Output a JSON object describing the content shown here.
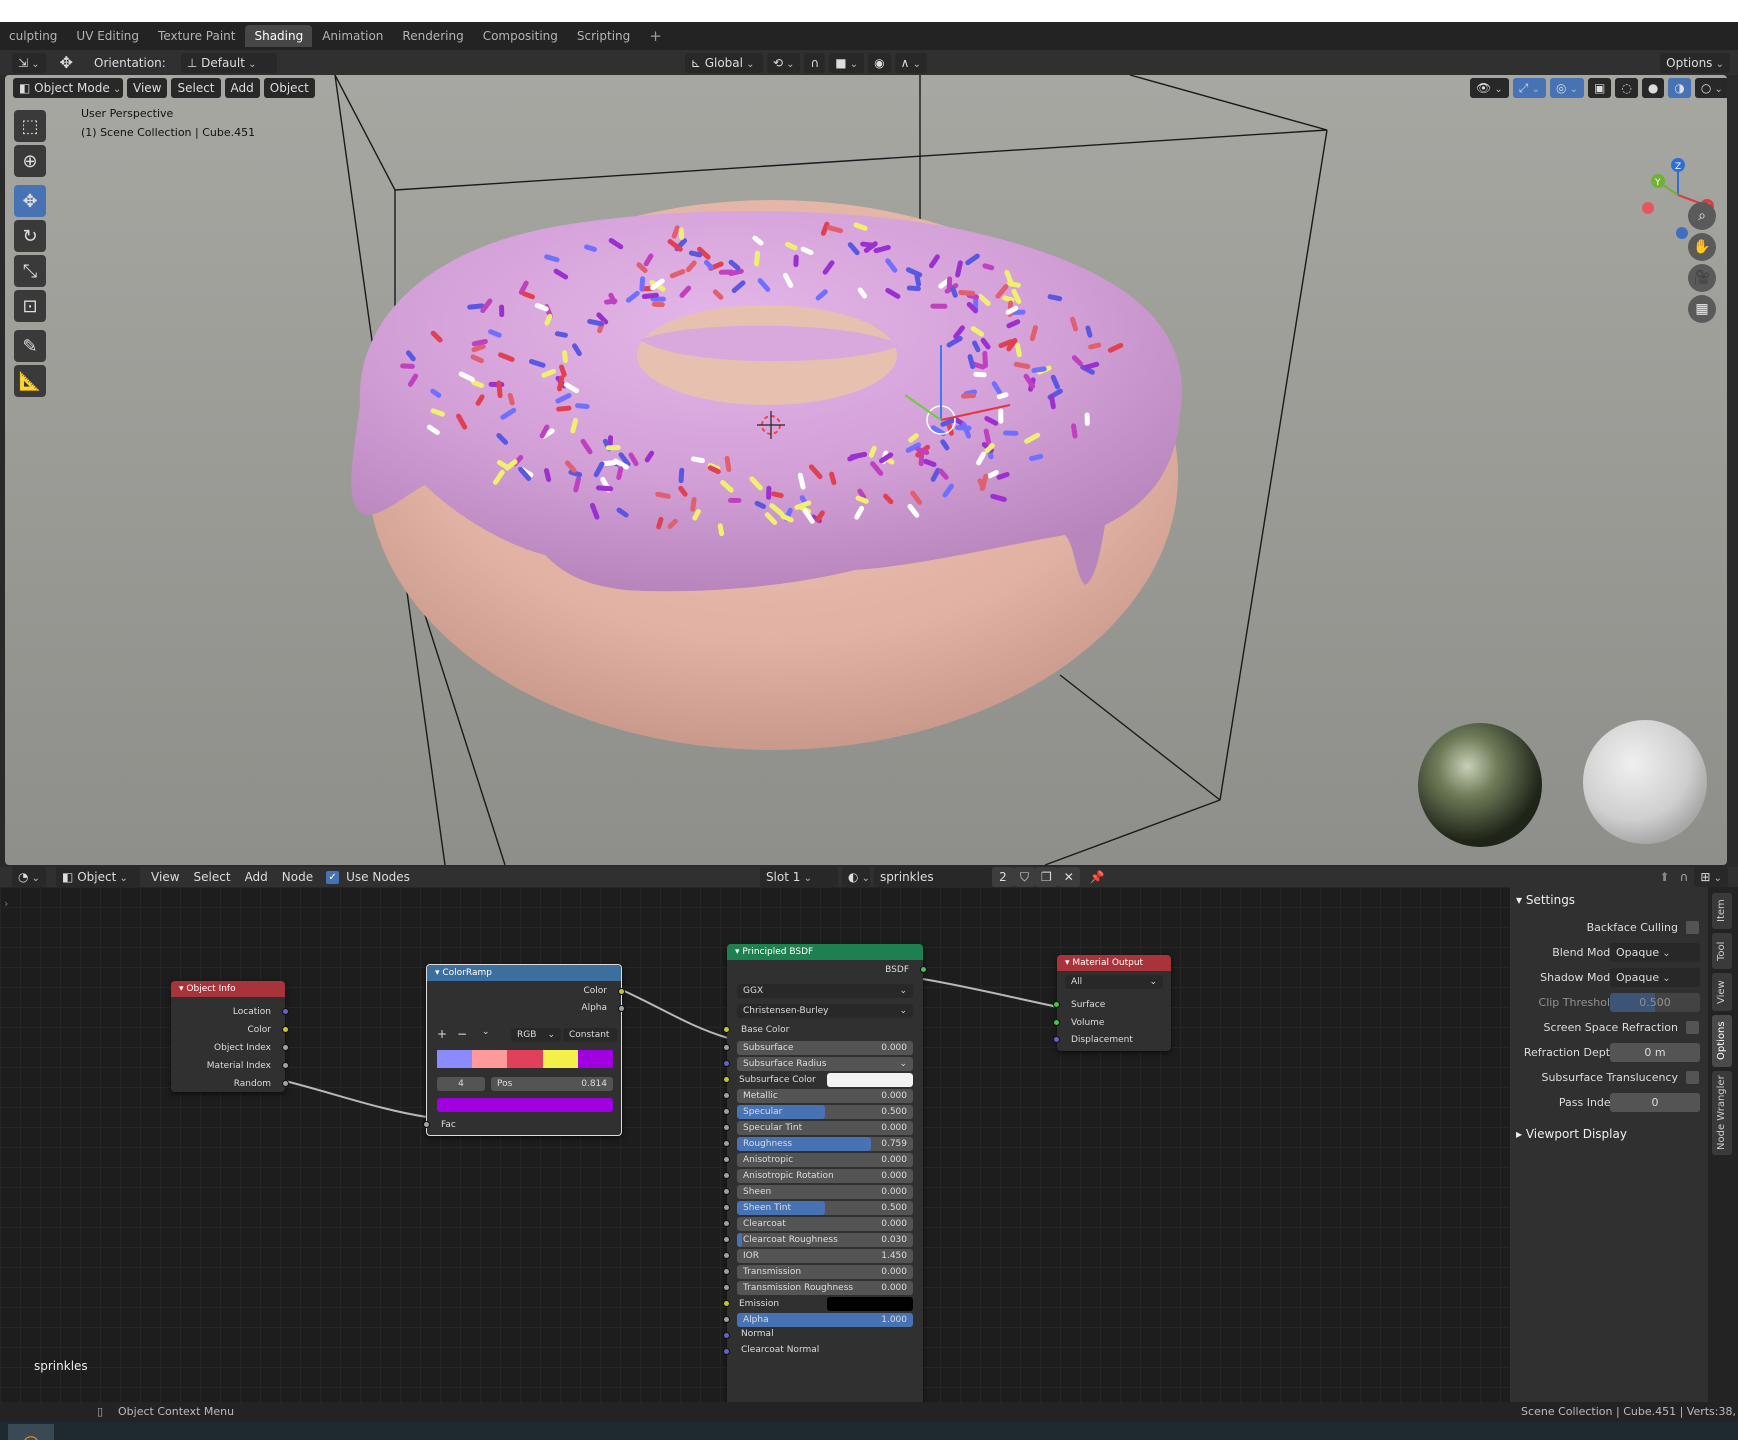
{
  "workspace_tabs": [
    "culpting",
    "UV Editing",
    "Texture Paint",
    "Shading",
    "Animation",
    "Rendering",
    "Compositing",
    "Scripting",
    "+"
  ],
  "active_tab": "Shading",
  "tool_header": {
    "orientation_label": "Orientation:",
    "orientation_value": "Default",
    "transform_orientation": "Global",
    "options": "Options"
  },
  "viewport_header": {
    "mode": "Object Mode",
    "menus": [
      "View",
      "Select",
      "Add",
      "Object"
    ]
  },
  "viewport": {
    "perspective": "User Perspective",
    "collection": "(1) Scene Collection | Cube.451",
    "gizmo_axes": [
      "Z",
      "Y",
      "X"
    ],
    "nav_icons": [
      "zoom-icon",
      "pan-hand-icon",
      "camera-icon",
      "grid-icon"
    ]
  },
  "toolbar_icons": [
    "select-box-icon",
    "cursor-icon",
    "move-icon",
    "rotate-icon",
    "scale-icon",
    "transform-icon",
    "annotate-icon",
    "measure-icon"
  ],
  "node_header": {
    "type": "Object",
    "menus": [
      "View",
      "Select",
      "Add",
      "Node"
    ],
    "use_nodes_label": "Use Nodes",
    "use_nodes_checked": true,
    "slot": "Slot 1",
    "material": "sprinkles",
    "users": "2"
  },
  "nodes": {
    "object_info": {
      "title": "Object Info",
      "outputs": [
        "Location",
        "Color",
        "Object Index",
        "Material Index",
        "Random"
      ]
    },
    "color_ramp": {
      "title": "ColorRamp",
      "outputs": [
        "Color",
        "Alpha"
      ],
      "mode": "RGB",
      "interpolation": "Constant",
      "active_index": "4",
      "pos_label": "Pos",
      "pos_value": "0.814",
      "input": "Fac",
      "stop_colors": [
        "#8b8bff",
        "#ff9a9a",
        "#e0405a",
        "#f4f04a",
        "#a000e0"
      ],
      "active_color": "#a000e0"
    },
    "principled": {
      "title": "Principled BSDF",
      "output": "BSDF",
      "distribution": "GGX",
      "subsurface_method": "Christensen-Burley",
      "base_color_label": "Base Color",
      "fields": [
        {
          "label": "Subsurface",
          "value": "0.000",
          "fill": 0
        },
        {
          "label": "Subsurface Radius",
          "value": "",
          "fill": 0
        },
        {
          "label": "Subsurface Color",
          "value": "",
          "fill": 0
        },
        {
          "label": "Metallic",
          "value": "0.000",
          "fill": 0
        },
        {
          "label": "Specular",
          "value": "0.500",
          "fill": 0.5
        },
        {
          "label": "Specular Tint",
          "value": "0.000",
          "fill": 0
        },
        {
          "label": "Roughness",
          "value": "0.759",
          "fill": 0.759
        },
        {
          "label": "Anisotropic",
          "value": "0.000",
          "fill": 0
        },
        {
          "label": "Anisotropic Rotation",
          "value": "0.000",
          "fill": 0
        },
        {
          "label": "Sheen",
          "value": "0.000",
          "fill": 0
        },
        {
          "label": "Sheen Tint",
          "value": "0.500",
          "fill": 0.5
        },
        {
          "label": "Clearcoat",
          "value": "0.000",
          "fill": 0
        },
        {
          "label": "Clearcoat Roughness",
          "value": "0.030",
          "fill": 0.03
        },
        {
          "label": "IOR",
          "value": "1.450",
          "fill": 0
        },
        {
          "label": "Transmission",
          "value": "0.000",
          "fill": 0
        },
        {
          "label": "Transmission Roughness",
          "value": "0.000",
          "fill": 0
        },
        {
          "label": "Emission",
          "value": "",
          "fill": 0
        },
        {
          "label": "Alpha",
          "value": "1.000",
          "fill": 1
        }
      ],
      "vector_inputs": [
        "Normal",
        "Clearcoat Normal"
      ]
    },
    "material_output": {
      "title": "Material Output",
      "target": "All",
      "inputs": [
        "Surface",
        "Volume",
        "Displacement"
      ]
    }
  },
  "node_editor_label": "sprinkles",
  "properties": {
    "settings_title": "Settings",
    "rows": [
      {
        "label": "Backface Culling",
        "type": "check"
      },
      {
        "label": "Blend Mode",
        "type": "select",
        "value": "Opaque"
      },
      {
        "label": "Shadow Mode",
        "type": "select",
        "value": "Opaque"
      },
      {
        "label": "Clip Threshold",
        "type": "field",
        "value": "0.500"
      },
      {
        "label": "Screen Space Refraction",
        "type": "check"
      },
      {
        "label": "Refraction Depth",
        "type": "field",
        "value": "0 m"
      },
      {
        "label": "Subsurface Translucency",
        "type": "check"
      },
      {
        "label": "Pass Index",
        "type": "field",
        "value": "0"
      }
    ],
    "viewport_display": "Viewport Display"
  },
  "side_tabs": [
    "Item",
    "Tool",
    "View",
    "Options",
    "Node Wrangler"
  ],
  "status": {
    "left": "Object Context Menu",
    "right": "Scene Collection | Cube.451 | Verts:38,"
  },
  "colors": {
    "accent": "#4772b3",
    "object_info_header": "#a8333b",
    "color_ramp_header": "#3c6e9e",
    "principled_header": "#1d8050",
    "material_output_header": "#a8333b",
    "icing": "#d7a2dc",
    "dough": "#e3b5a8"
  }
}
